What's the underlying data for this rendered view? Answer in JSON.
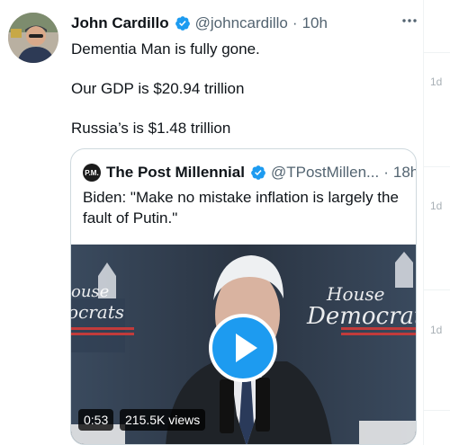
{
  "tweet": {
    "author_name": "John Cardillo",
    "author_handle": "@johncardillo",
    "separator": "·",
    "time": "10h",
    "lines": [
      "Dementia Man is fully gone.",
      "Our GDP is $20.94 trillion",
      "Russia’s is $1.48 trillion"
    ]
  },
  "quote": {
    "avatar_text": "P.M.",
    "author_name": "The Post Millennial",
    "author_handle": "@TPostMillen...",
    "separator": "·",
    "time": "18h",
    "text": "Biden: \"Make no mistake inflation is largely the fault of Putin.\"",
    "video": {
      "duration": "0:53",
      "views": "215.5K views",
      "banner_text": "House Democrats"
    }
  },
  "background_timestamps": [
    "1d",
    "1d",
    "1d"
  ],
  "colors": {
    "verified": "#1d9bf0",
    "play_button": "#1d9bf0",
    "secondary_text": "#536471",
    "border": "#cfd9de"
  },
  "icons": [
    "verified-badge-icon",
    "more-options-icon",
    "play-icon"
  ]
}
